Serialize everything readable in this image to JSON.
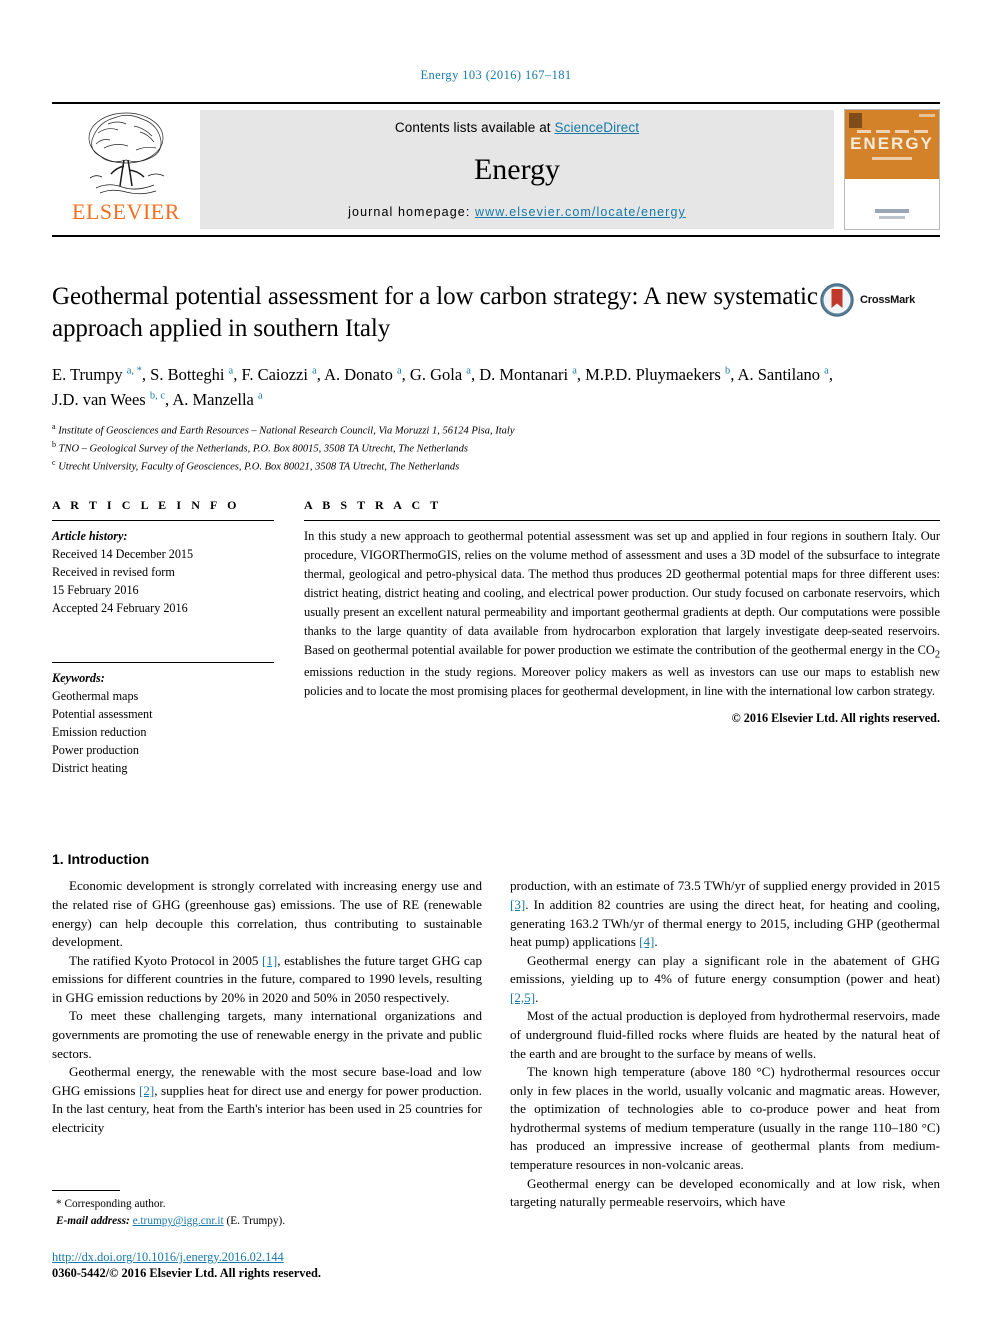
{
  "running_head": "Energy 103 (2016) 167–181",
  "masthead": {
    "publisher": "ELSEVIER",
    "contents_text": "Contents lists available at ",
    "sciencedirect_link": "ScienceDirect",
    "journal_name": "Energy",
    "homepage_prefix": "journal homepage: ",
    "homepage_url": "www.elsevier.com/locate/energy",
    "cover_title": "ENERGY",
    "link_color": "#1879a8"
  },
  "article": {
    "title": "Geothermal potential assessment for a low carbon strategy: A new systematic approach applied in southern Italy",
    "crossmark_label": "CrossMark",
    "authors_html": "E. Trumpy <sup>a, *</sup>, S. Botteghi <sup>a</sup>, F. Caiozzi <sup>a</sup>, A. Donato <sup>a</sup>, G. Gola <sup>a</sup>, D. Montanari <sup>a</sup>, M.P.D. Pluymaekers <sup>b</sup>, A. Santilano <sup>a</sup>, J.D. van Wees <sup>b, c</sup>, A. Manzella <sup>a</sup>",
    "affiliations": [
      {
        "marker": "a",
        "text": "Institute of Geosciences and Earth Resources – National Research Council, Via Moruzzi 1, 56124 Pisa, Italy"
      },
      {
        "marker": "b",
        "text": "TNO – Geological Survey of the Netherlands, P.O. Box 80015, 3508 TA Utrecht, The Netherlands"
      },
      {
        "marker": "c",
        "text": "Utrecht University, Faculty of Geosciences, P.O. Box 80021, 3508 TA Utrecht, The Netherlands"
      }
    ]
  },
  "article_info": {
    "heading": "A R T I C L E   I N F O",
    "history_label": "Article history:",
    "history": [
      "Received 14 December 2015",
      "Received in revised form",
      "15 February 2016",
      "Accepted 24 February 2016"
    ],
    "keywords_label": "Keywords:",
    "keywords": [
      "Geothermal maps",
      "Potential assessment",
      "Emission reduction",
      "Power production",
      "District heating"
    ]
  },
  "abstract": {
    "heading": "A B S T R A C T",
    "text_part1": "In this study a new approach to geothermal potential assessment was set up and applied in four regions in southern Italy. Our procedure, VIGORThermoGIS, relies on the volume method of assessment and uses a 3D model of the subsurface to integrate thermal, geological and petro-physical data. The method thus produces 2D geothermal potential maps for three different uses: district heating, district heating and cooling, and electrical power production. Our study focused on carbonate reservoirs, which usually present an excellent natural permeability and important geothermal gradients at depth. Our computations were possible thanks to the large quantity of data available from hydrocarbon exploration that largely investigate deep-seated reservoirs. Based on geothermal potential available for power production we estimate the contribution of the geothermal energy in the CO",
    "subscript": "2",
    "text_part2": " emissions reduction in the study regions. Moreover policy makers as well as investors can use our maps to establish new policies and to locate the most promising places for geothermal development, in line with the international low carbon strategy.",
    "copyright": "© 2016 Elsevier Ltd. All rights reserved."
  },
  "body": {
    "section_heading": "1. Introduction",
    "left_column": [
      {
        "segments": [
          {
            "type": "text",
            "value": "Economic development is strongly correlated with increasing energy use and the related rise of GHG (greenhouse gas) emissions. The use of RE (renewable energy) can help decouple this correlation, thus contributing to sustainable development."
          }
        ]
      },
      {
        "segments": [
          {
            "type": "text",
            "value": "The ratified Kyoto Protocol in 2005 "
          },
          {
            "type": "cite",
            "value": "[1]"
          },
          {
            "type": "text",
            "value": ", establishes the future target GHG cap emissions for different countries in the future, compared to 1990 levels, resulting in GHG emission reductions by 20% in 2020 and 50% in 2050 respectively."
          }
        ]
      },
      {
        "segments": [
          {
            "type": "text",
            "value": "To meet these challenging targets, many international organizations and governments are promoting the use of renewable energy in the private and public sectors."
          }
        ]
      },
      {
        "segments": [
          {
            "type": "text",
            "value": "Geothermal energy, the renewable with the most secure base-load and low GHG emissions "
          },
          {
            "type": "cite",
            "value": "[2]"
          },
          {
            "type": "text",
            "value": ", supplies heat for direct use and energy for power production. In the last century, heat from the Earth's interior has been used in 25 countries for electricity"
          }
        ]
      }
    ],
    "right_column": [
      {
        "segments": [
          {
            "type": "text",
            "value": "production, with an estimate of 73.5 TWh/yr of supplied energy provided in 2015 "
          },
          {
            "type": "cite",
            "value": "[3]"
          },
          {
            "type": "text",
            "value": ". In addition 82 countries are using the direct heat, for heating and cooling, generating 163.2 TWh/yr of thermal energy to 2015, including GHP (geothermal heat pump) applications "
          },
          {
            "type": "cite",
            "value": "[4]"
          },
          {
            "type": "text",
            "value": "."
          }
        ],
        "noindent": true
      },
      {
        "segments": [
          {
            "type": "text",
            "value": "Geothermal energy can play a significant role in the abatement of GHG emissions, yielding up to 4% of future energy consumption (power and heat) "
          },
          {
            "type": "cite",
            "value": "[2,5]"
          },
          {
            "type": "text",
            "value": "."
          }
        ]
      },
      {
        "segments": [
          {
            "type": "text",
            "value": "Most of the actual production is deployed from hydrothermal reservoirs, made of underground fluid-filled rocks where fluids are heated by the natural heat of the earth and are brought to the surface by means of wells."
          }
        ]
      },
      {
        "segments": [
          {
            "type": "text",
            "value": "The known high temperature (above 180 °C) hydrothermal resources occur only in few places in the world, usually volcanic and magmatic areas. However, the optimization of technologies able to co-produce power and heat from hydrothermal systems of medium temperature (usually in the range 110–180 °C) has produced an impressive increase of geothermal plants from medium-temperature resources in non-volcanic areas."
          }
        ]
      },
      {
        "segments": [
          {
            "type": "text",
            "value": "Geothermal energy can be developed economically and at low risk, when targeting naturally permeable reservoirs, which have"
          }
        ]
      }
    ]
  },
  "footnote": {
    "corresponding_marker": "*",
    "corresponding_label": "Corresponding author.",
    "email_label": "E-mail address:",
    "email": "e.trumpy@igg.cnr.it",
    "email_owner": "(E. Trumpy).",
    "doi": "http://dx.doi.org/10.1016/j.energy.2016.02.144",
    "issn": "0360-5442/© 2016 Elsevier Ltd. All rights reserved."
  }
}
